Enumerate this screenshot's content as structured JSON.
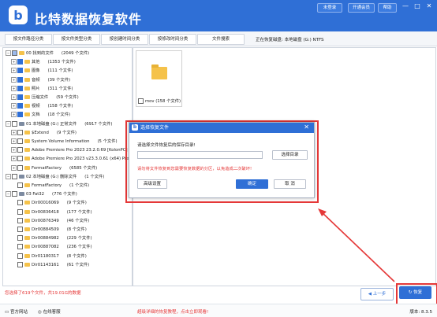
{
  "app": {
    "title": "比特数据恢复软件",
    "logo_letter": "b"
  },
  "header": {
    "register": "未登录",
    "vip": "开通会员",
    "manual": "帮助"
  },
  "window": {
    "minimize": "—",
    "maximize": "□",
    "close": "✕"
  },
  "tabs": [
    "按文件路径分类",
    "按文件类型分类",
    "按创建时间分类",
    "按修改时间分类",
    "文件搜索"
  ],
  "tab_info": "正在恢复磁盘: 本地磁盘 (G:) NTFS",
  "tree": [
    {
      "label": "00 找到的文件",
      "count": "(2049 个文件)",
      "level": 0,
      "exp": "−",
      "check": "part",
      "icon": "folder"
    },
    {
      "label": "其他",
      "count": "(1353 个文件)",
      "level": 1,
      "exp": "+",
      "check": "on",
      "icon": "folder"
    },
    {
      "label": "图像",
      "count": "(111 个文件)",
      "level": 1,
      "exp": "+",
      "check": "on",
      "icon": "folder"
    },
    {
      "label": "音频",
      "count": "(39 个文件)",
      "level": 1,
      "exp": "+",
      "check": "on",
      "icon": "folder"
    },
    {
      "label": "照片",
      "count": "(311 个文件)",
      "level": 1,
      "exp": "+",
      "check": "on",
      "icon": "folder"
    },
    {
      "label": "压缩文件",
      "count": "(59 个文件)",
      "level": 1,
      "exp": "+",
      "check": "on",
      "icon": "folder"
    },
    {
      "label": "视频",
      "count": "(158 个文件)",
      "level": 1,
      "exp": "+",
      "check": "on",
      "icon": "folder"
    },
    {
      "label": "文档",
      "count": "(18 个文件)",
      "level": 1,
      "exp": "+",
      "check": "on",
      "icon": "folder"
    },
    {
      "label": "01 本地磁盘 (G:) 正常文件",
      "count": "(6917 个文件)",
      "level": 0,
      "exp": "−",
      "check": "off",
      "icon": "drive"
    },
    {
      "label": "$Extend",
      "count": "(9 个文件)",
      "level": 1,
      "exp": "+",
      "check": "off",
      "icon": "folder"
    },
    {
      "label": "System Volume Information",
      "count": "(5 个文件)",
      "level": 1,
      "exp": "+",
      "check": "off",
      "icon": "folder"
    },
    {
      "label": "Adobe Premiere Pro 2023 23.2.0.69 [KolonPC]",
      "count": "(1 个文件)",
      "level": 1,
      "exp": "+",
      "check": "off",
      "icon": "folder"
    },
    {
      "label": "Adobe Premiere Pro 2023 v23.3.0.61 (x64) Pre-",
      "count": "",
      "level": 1,
      "exp": "+",
      "check": "off",
      "icon": "folder"
    },
    {
      "label": "FormatFactory",
      "count": "(6585 个文件)",
      "level": 1,
      "exp": "+",
      "check": "off",
      "icon": "folder"
    },
    {
      "label": "02 本地磁盘 (G:) 删除文件",
      "count": "(1 个文件)",
      "level": 0,
      "exp": "−",
      "check": "off",
      "icon": "drive"
    },
    {
      "label": "FormatFactory",
      "count": "(1 个文件)",
      "level": 1,
      "exp": "",
      "check": "off",
      "icon": "folder"
    },
    {
      "label": "03 Fat32",
      "count": "(776 个文件)",
      "level": 0,
      "exp": "−",
      "check": "off",
      "icon": "drive"
    },
    {
      "label": "Dir00016069",
      "count": "(9 个文件)",
      "level": 1,
      "exp": "",
      "check": "off",
      "icon": "folder"
    },
    {
      "label": "Dir00836418",
      "count": "(177 个文件)",
      "level": 1,
      "exp": "",
      "check": "off",
      "icon": "folder"
    },
    {
      "label": "Dir00876349",
      "count": "(46 个文件)",
      "level": 1,
      "exp": "",
      "check": "off",
      "icon": "folder"
    },
    {
      "label": "Dir00884509",
      "count": "(8 个文件)",
      "level": 1,
      "exp": "",
      "check": "off",
      "icon": "folder"
    },
    {
      "label": "Dir00884982",
      "count": "(229 个文件)",
      "level": 1,
      "exp": "",
      "check": "off",
      "icon": "folder"
    },
    {
      "label": "Dir00887082",
      "count": "(236 个文件)",
      "level": 1,
      "exp": "",
      "check": "off",
      "icon": "folder"
    },
    {
      "label": "Dir01180317",
      "count": "(8 个文件)",
      "level": 1,
      "exp": "",
      "check": "off",
      "icon": "folder"
    },
    {
      "label": "Dir01143161",
      "count": "(61 个文件)",
      "level": 1,
      "exp": "",
      "check": "off",
      "icon": "folder"
    }
  ],
  "preview": {
    "folder_label": "mov",
    "folder_count": "(158 个文件)"
  },
  "dialog": {
    "title": "选择恢复文件",
    "prompt": "请选择文件恢复后的保存目录!",
    "path_value": "",
    "browse": "选择目录",
    "warning": "请勿将文件恢复到您需要恢复数据的分区，以免造成二次破坏!",
    "advanced": "高级设置",
    "ok": "确定",
    "cancel": "取 消"
  },
  "status": {
    "selected": "您选择了619个文件，共19.01G的数据"
  },
  "buttons": {
    "prev": "上一步",
    "recover": "恢复"
  },
  "footer": {
    "website": "官方网站",
    "service": "在线客服",
    "tutorial": "超级详细的恢复教程，点击立即观看!",
    "version": "版本: 8.3.5"
  },
  "colors": {
    "brand": "#2f6fd6",
    "alert": "#e53838"
  },
  "icons": {
    "prev": "left-arrow-icon",
    "recover": "refresh-icon",
    "website": "monitor-icon",
    "service": "headset-icon"
  }
}
